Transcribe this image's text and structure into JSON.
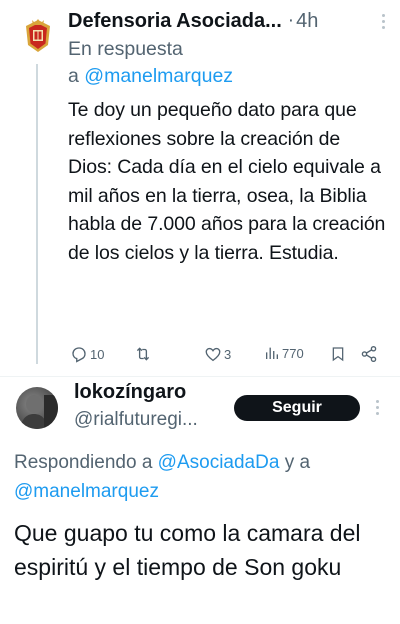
{
  "tweet1": {
    "author_name": "Defensoria Asociada...",
    "separator": "·",
    "time": "4h",
    "reply_prefix": "En respuesta",
    "reply_to_word": "a",
    "reply_to_handle": "@manelmarquez",
    "body": "Te doy un pequeño dato para que reflexiones sobre la creación de Dios: Cada día en el cielo equivale a mil años en la tierra, osea, la Biblia habla de 7.000 años para la creación de los cielos y la tierra. Estudia.",
    "actions": {
      "replies": "10",
      "retweets": "",
      "likes": "3",
      "views": "770"
    }
  },
  "tweet2": {
    "author_name": "lokozíngaro",
    "handle": "@rialfuturegi...",
    "follow_label": "Seguir",
    "replying_prefix": "Respondiendo a",
    "replying_handle_1": "@AsociadaDa",
    "replying_and": "y a",
    "replying_handle_2": "@manelmarquez",
    "body": "Que guapo tu como la camara del espiritú y el tiempo de Son goku"
  },
  "colors": {
    "text": "#0f1419",
    "muted": "#536471",
    "link": "#1d9bf0",
    "button_bg": "#0f1419",
    "logo_red": "#c8281e",
    "logo_gold": "#d9a53a"
  }
}
